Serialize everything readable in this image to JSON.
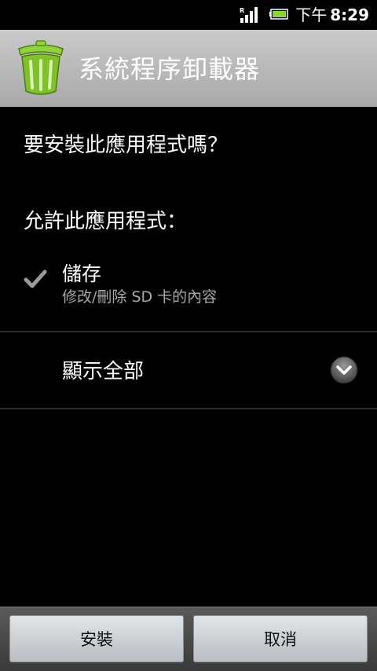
{
  "status_bar": {
    "ampm": "下午",
    "time": "8:29"
  },
  "header": {
    "app_title": "系統程序卸載器",
    "icon": "trash-can-icon"
  },
  "main": {
    "question": "要安裝此應用程式嗎？",
    "allow_label": "允許此應用程式：",
    "permissions": [
      {
        "title": "儲存",
        "description": "修改/刪除 SD 卡的內容",
        "icon": "checkmark-icon"
      }
    ],
    "show_all_label": "顯示全部"
  },
  "buttons": {
    "install_label": "安裝",
    "cancel_label": "取消"
  },
  "colors": {
    "title_bar": "#b8b8b8",
    "icon_green": "#7ec12b",
    "background": "#000000",
    "secondary_text": "#a8a8a8"
  }
}
